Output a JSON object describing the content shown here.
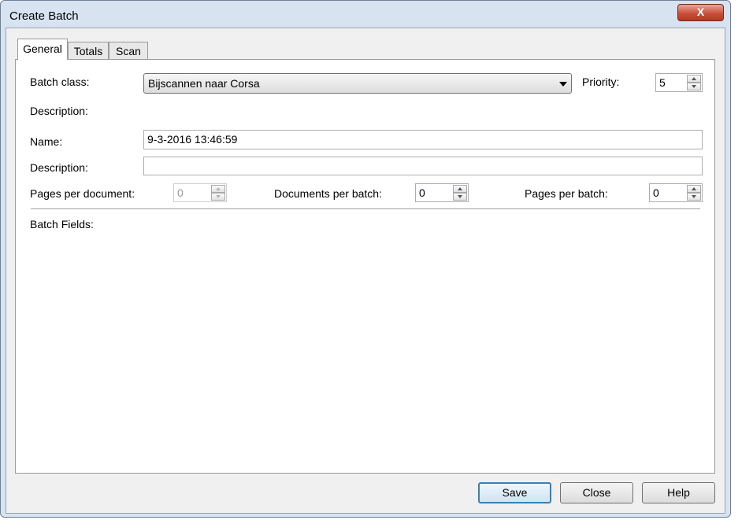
{
  "window": {
    "title": "Create Batch",
    "close_glyph": "X"
  },
  "tabs": [
    {
      "label": "General"
    },
    {
      "label": "Totals"
    },
    {
      "label": "Scan"
    }
  ],
  "general": {
    "batch_class_label": "Batch class:",
    "batch_class_value": "Bijscannen naar Corsa",
    "priority_label": "Priority:",
    "priority_value": "5",
    "description_label": "Description:",
    "name_label": "Name:",
    "name_value": "9-3-2016 13:46:59",
    "description2_label": "Description:",
    "description2_value": "",
    "pages_per_document_label": "Pages per document:",
    "pages_per_document_value": "0",
    "documents_per_batch_label": "Documents per batch:",
    "documents_per_batch_value": "0",
    "pages_per_batch_label": "Pages per batch:",
    "pages_per_batch_value": "0",
    "batch_fields_label": "Batch Fields:"
  },
  "buttons": {
    "save": "Save",
    "close": "Close",
    "help": "Help"
  },
  "colors": {
    "close_button": "#c9503b",
    "default_button_border": "#3c7fb1",
    "frame": "#d7e3f0"
  }
}
